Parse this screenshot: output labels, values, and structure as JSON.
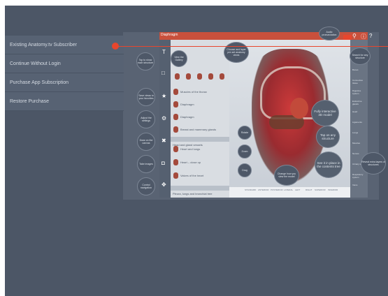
{
  "menu": [
    "Existing Anatomy.tv Subscriber",
    "Continue Without Login",
    "Purchase App Subscription",
    "Restore Purchase"
  ],
  "app": {
    "title": "Diaphragm",
    "list": {
      "sections": [
        "Head and gland vessels",
        "Pleura, lungs and bronchial tree"
      ],
      "items": [
        "Muscles of the thorax",
        "Diaphragm",
        "Diaphragm",
        "Breast and mammary glands",
        "Heart and lungs",
        "Heart – close up",
        "Valves of the heart"
      ]
    },
    "systems": [
      "Skeletal system",
      "Bones",
      "Connective tissue",
      "Digestive system",
      "Endocrine glands",
      "Heart",
      "Ligaments",
      "Lungs",
      "Muscles",
      "Nerves",
      "Urinary system",
      "Respiratory system",
      "Veins"
    ],
    "toolbar": [
      "STANDARD",
      "ANTERIOR",
      "POSTERIOR",
      "LATERAL",
      "LEFT",
      "RIGHT",
      "SUPERIOR",
      "INFERIOR"
    ]
  },
  "callouts": {
    "audio": "Audio pronunciation",
    "search": "Search for any structure",
    "view_gallery": "View the Gallery",
    "choose_layer": "Choose and layer pre-set anatomy views",
    "fully_3d": "Fully interactive 3D model",
    "tap": "Tap on any structure",
    "see_in_tree": "See it in place in the contents tree",
    "reveal": "Reveal extra layers of structures",
    "change": "Change how you view the model",
    "rotate": "Rotate",
    "zoom": "Zoom",
    "drag": "Drag",
    "left1": "Tap to show each structure",
    "left2": "Save views to your favorites",
    "left3": "Adjust the settings",
    "left4": "Draw on the canvas",
    "left5": "Take images",
    "left6": "Control navigation"
  },
  "colors": {
    "accent": "#e8462d",
    "background": "#4c5666",
    "menu": "#576273"
  }
}
